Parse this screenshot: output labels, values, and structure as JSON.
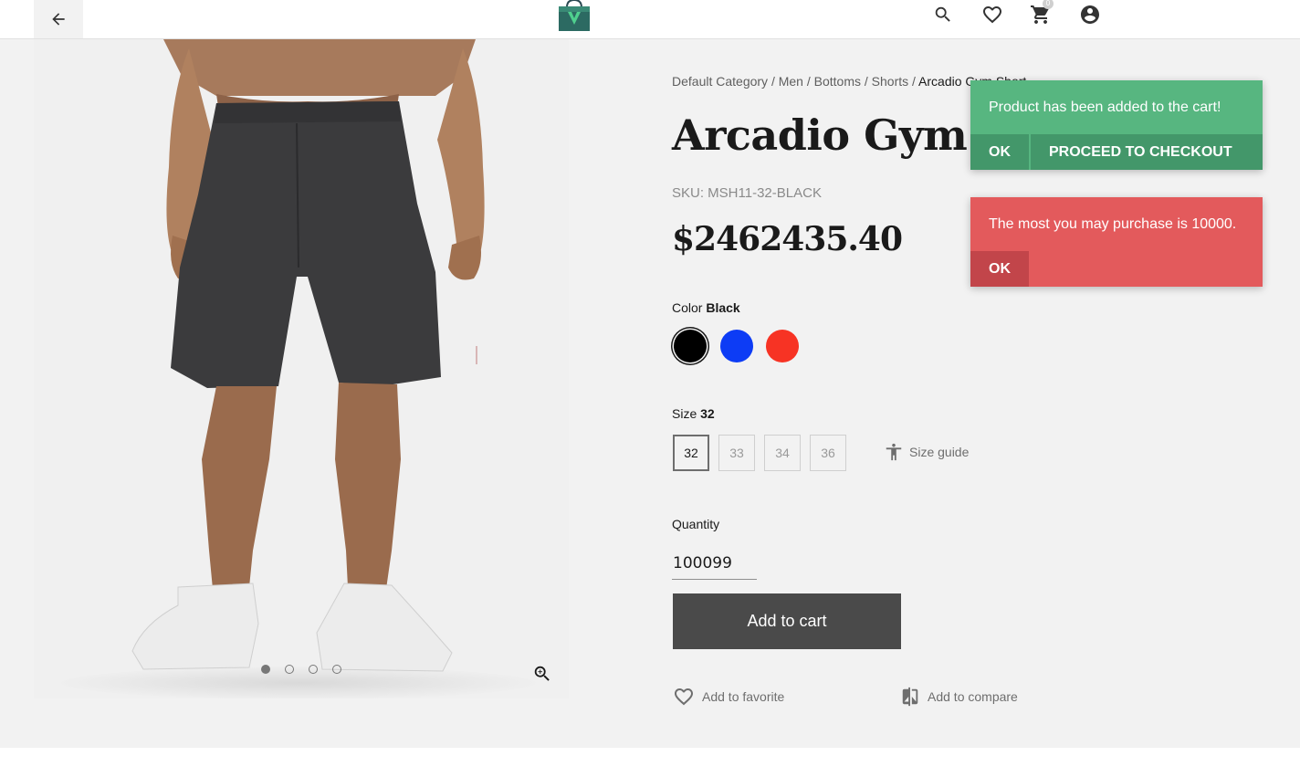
{
  "header": {
    "back_icon": "arrow-left-icon",
    "logo_icon": "shopping-bag-logo",
    "icons": [
      "search-icon",
      "heart-icon",
      "cart-icon",
      "account-icon"
    ],
    "cart_count": "0"
  },
  "breadcrumb": [
    {
      "label": "Default Category"
    },
    {
      "label": "Men"
    },
    {
      "label": "Bottoms"
    },
    {
      "label": "Shorts"
    },
    {
      "label": "Arcadio Gym Short"
    }
  ],
  "breadcrumb_separator": " / ",
  "product": {
    "title": "Arcadio Gym Short",
    "sku": "SKU: MSH11-32-BLACK",
    "price": "$2462435.40"
  },
  "color": {
    "label": "Color",
    "selected": "Black",
    "swatches": [
      {
        "name": "Black",
        "hex": "#000000"
      },
      {
        "name": "Blue",
        "hex": "#0d3cf5"
      },
      {
        "name": "Red",
        "hex": "#f73324"
      }
    ]
  },
  "size": {
    "label": "Size",
    "selected": "32",
    "options": [
      "32",
      "33",
      "34",
      "36"
    ],
    "guide_label": "Size guide"
  },
  "quantity": {
    "label": "Quantity",
    "value": "100099"
  },
  "actions": {
    "add_to_cart": "Add to cart",
    "add_to_favorite": "Add to favorite",
    "add_to_compare": "Add to compare"
  },
  "gallery": {
    "dot_count": 4,
    "active_dot": 0
  },
  "notifications": {
    "success": {
      "message": "Product has been added to the cart!",
      "ok": "OK",
      "checkout": "PROCEED TO CHECKOUT",
      "color": "#57b680"
    },
    "error": {
      "message": "The most you may purchase is 10000.",
      "ok": "OK",
      "color": "#e35a5c"
    }
  }
}
